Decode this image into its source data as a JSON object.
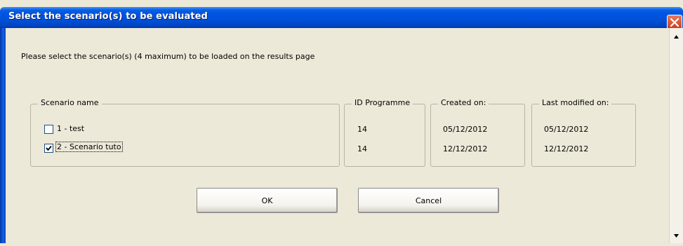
{
  "window": {
    "title": "Select the scenario(s) to be evaluated"
  },
  "instructions": "Please select the scenario(s) (4 maximum) to be loaded on the results page",
  "columns": {
    "scenario_name": "Scenario name",
    "id_programme": "ID Programme",
    "created_on": "Created on:",
    "last_modified_on": "Last modified on:"
  },
  "scenarios": [
    {
      "label": "1 - test",
      "checked": false,
      "id": "14",
      "created": "05/12/2012",
      "modified": "05/12/2012"
    },
    {
      "label": "2 - Scenario tuto",
      "checked": true,
      "id": "14",
      "created": "12/12/2012",
      "modified": "12/12/2012"
    }
  ],
  "buttons": {
    "ok": "OK",
    "cancel": "Cancel"
  },
  "icons": {
    "close": "close-icon",
    "scroll_up": "arrow-up-icon",
    "scroll_down": "arrow-down-icon",
    "check": "checkmark-icon"
  },
  "colors": {
    "titlebar": "#0054e3",
    "dialog_bg": "#ece9d8",
    "close_button": "#c8381c"
  }
}
